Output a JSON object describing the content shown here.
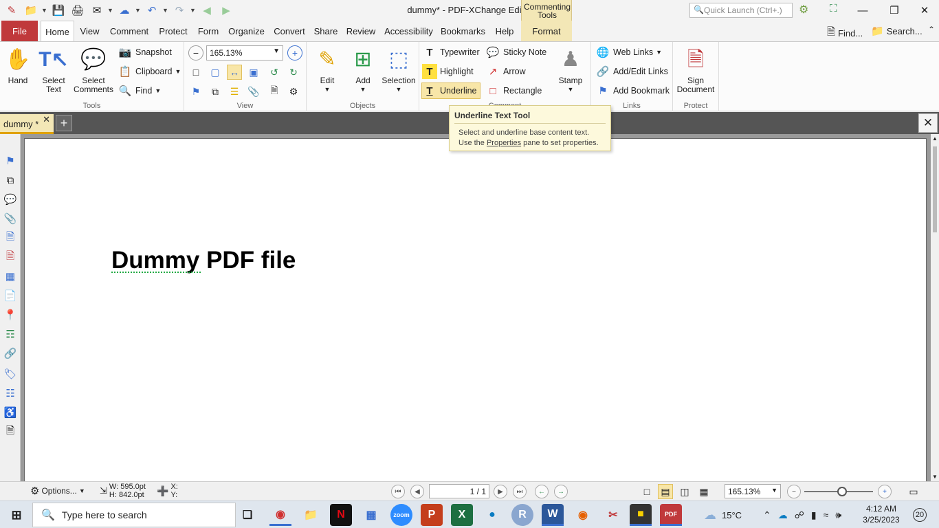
{
  "window": {
    "title": "dummy* - PDF-XChange Editor",
    "context_tab_group": "Commenting Tools",
    "quick_launch_placeholder": "Quick Launch (Ctrl+.)",
    "controls": [
      "minimize",
      "maximize",
      "close"
    ]
  },
  "quick_access": [
    "app-logo",
    "open-folder",
    "save",
    "print",
    "email",
    "scan",
    "undo",
    "redo",
    "back",
    "forward"
  ],
  "menu": {
    "file": "File",
    "tabs": [
      "Home",
      "View",
      "Comment",
      "Protect",
      "Form",
      "Organize",
      "Convert",
      "Share",
      "Review",
      "Accessibility",
      "Bookmarks",
      "Help"
    ],
    "context_tab": "Format",
    "active_tab": "Home",
    "find": "Find...",
    "search": "Search..."
  },
  "ribbon": {
    "tools": {
      "label": "Tools",
      "hand": "Hand",
      "select_text_1": "Select",
      "select_text_2": "Text",
      "select_comments_1": "Select",
      "select_comments_2": "Comments",
      "snapshot": "Snapshot",
      "clipboard": "Clipboard",
      "find": "Find"
    },
    "view": {
      "label": "View",
      "zoom": "165.13%"
    },
    "objects": {
      "label": "Objects",
      "edit": "Edit",
      "add": "Add",
      "selection": "Selection"
    },
    "comment": {
      "label": "Comment",
      "typewriter": "Typewriter",
      "sticky_note": "Sticky Note",
      "highlight": "Highlight",
      "arrow": "Arrow",
      "underline": "Underline",
      "rectangle": "Rectangle",
      "stamp": "Stamp"
    },
    "links": {
      "label": "Links",
      "web_links": "Web Links",
      "add_edit_links": "Add/Edit Links",
      "add_bookmark": "Add Bookmark"
    },
    "protect": {
      "label": "Protect",
      "sign_1": "Sign",
      "sign_2": "Document"
    }
  },
  "tooltip": {
    "title": "Underline Text Tool",
    "line1": "Select and underline base content text.",
    "line2_pre": "Use the ",
    "line2_link": "Properties",
    "line2_post": " pane to set properties."
  },
  "document": {
    "tab_name": "dummy *",
    "heading": "Dummy PDF file"
  },
  "statusbar": {
    "options": "Options...",
    "width": "W: 595.0pt",
    "height": "H: 842.0pt",
    "x": "X:",
    "y": "Y:",
    "page": "1 / 1",
    "zoom": "165.13%"
  },
  "taskbar": {
    "search_placeholder": "Type here to search",
    "weather": "15°C",
    "time": "4:12 AM",
    "date": "3/25/2023",
    "notifications": "20"
  }
}
